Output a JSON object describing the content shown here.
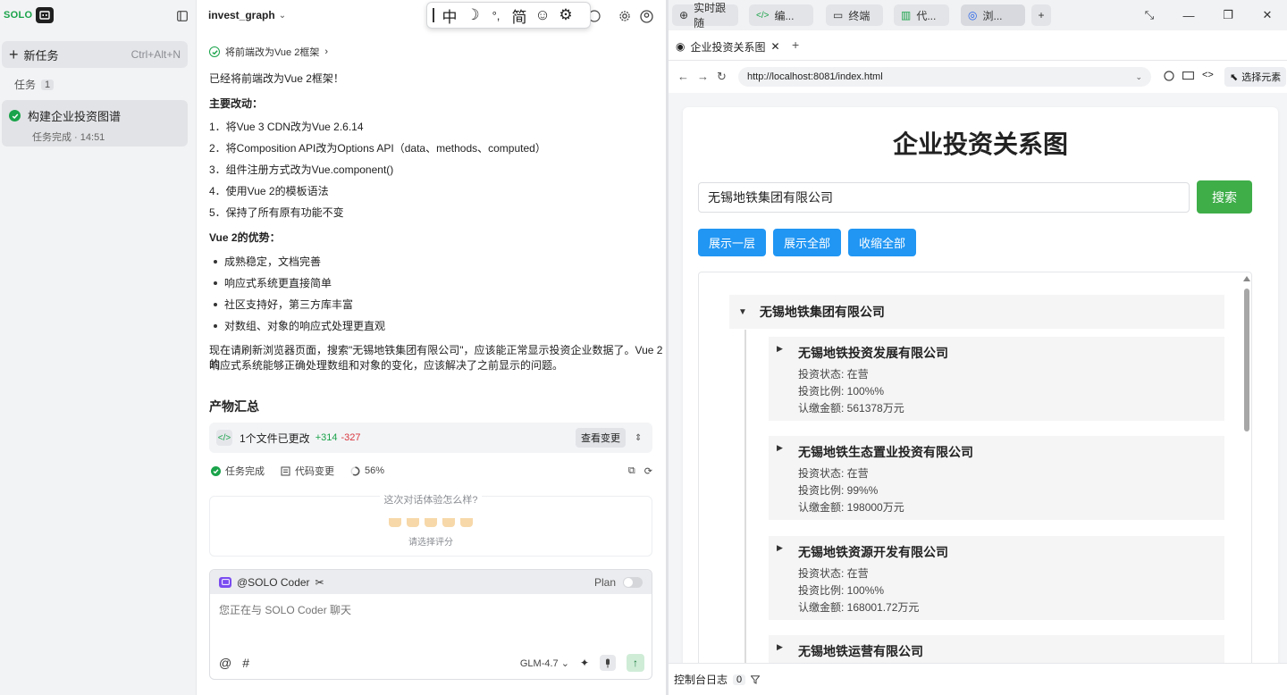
{
  "sidebar": {
    "logo": "SOLO",
    "new_task": {
      "label": "新任务",
      "shortcut": "Ctrl+Alt+N"
    },
    "tasks_label": "任务",
    "tasks_count": "1",
    "task": {
      "title": "构建企业投资图谱",
      "status": "任务完成 · 14:51"
    }
  },
  "chat": {
    "project": "invest_graph",
    "ime": {
      "chinese": "中",
      "punct": "°,",
      "simplified": "简"
    },
    "step": "将前端改为Vue 2框架",
    "intro": "已经将前端改为Vue 2框架！",
    "changes_title": "主要改动：",
    "changes": [
      "1．将Vue 3 CDN改为Vue 2.6.14",
      "2．将Composition API改为Options API（data、methods、computed）",
      "3．组件注册方式改为Vue.component()",
      "4．使用Vue 2的模板语法",
      "5．保持了所有原有功能不变"
    ],
    "advantages_title": "Vue 2的优势：",
    "advantages": [
      "成熟稳定，文档完善",
      "响应式系统更直接简单",
      "社区支持好，第三方库丰富",
      "对数组、对象的响应式处理更直观"
    ],
    "outro_line1": "现在请刷新浏览器页面，搜索\"无锡地铁集团有限公司\"，应该能正常显示投资企业数据了。Vue 2的",
    "outro_line2": "响应式系统能够正确处理数组和对象的变化，应该解决了之前显示的问题。",
    "summary_title": "产物汇总",
    "files": {
      "changed": "1个文件已更改",
      "added": "+314",
      "removed": "-327",
      "view_button": "查看变更"
    },
    "status": {
      "done": "任务完成",
      "code_changes": "代码变更",
      "progress": "56%"
    },
    "rating": {
      "question": "这次对话体验怎么样?",
      "hint": "请选择评分"
    },
    "composer": {
      "agent": "@SOLO Coder",
      "plan_label": "Plan",
      "placeholder": "您正在与 SOLO Coder 聊天",
      "at": "@",
      "hash": "#",
      "model": "GLM-4.7"
    }
  },
  "browser": {
    "panel_tabs": [
      {
        "label": "实时跟随"
      },
      {
        "label": "编..."
      },
      {
        "label": "终端"
      },
      {
        "label": "代..."
      },
      {
        "label": "浏..."
      }
    ],
    "page_tab": "企业投资关系图",
    "url": "http://localhost:8081/index.html",
    "pick_element": "选择元素",
    "console_label": "控制台日志",
    "console_count": "0"
  },
  "app": {
    "title": "企业投资关系图",
    "search_value": "无锡地铁集团有限公司",
    "search_button": "搜索",
    "buttons": {
      "expand_one": "展示一层",
      "expand_all": "展示全部",
      "collapse_all": "收缩全部"
    },
    "root": "无锡地铁集团有限公司",
    "companies": [
      {
        "name": "无锡地铁投资发展有限公司",
        "status": "投资状态: 在营",
        "ratio": "投资比例: 100%%",
        "amount": "认缴金额: 561378万元"
      },
      {
        "name": "无锡地铁生态置业投资有限公司",
        "status": "投资状态: 在营",
        "ratio": "投资比例: 99%%",
        "amount": "认缴金额: 198000万元"
      },
      {
        "name": "无锡地铁资源开发有限公司",
        "status": "投资状态: 在营",
        "ratio": "投资比例: 100%%",
        "amount": "认缴金额: 168001.72万元"
      },
      {
        "name": "无锡地铁运营有限公司",
        "status": "",
        "ratio": "",
        "amount": ""
      }
    ]
  },
  "colors": {
    "accent_green": "#1aa34a",
    "button_blue": "#2196f3",
    "search_green": "#3fae49"
  }
}
